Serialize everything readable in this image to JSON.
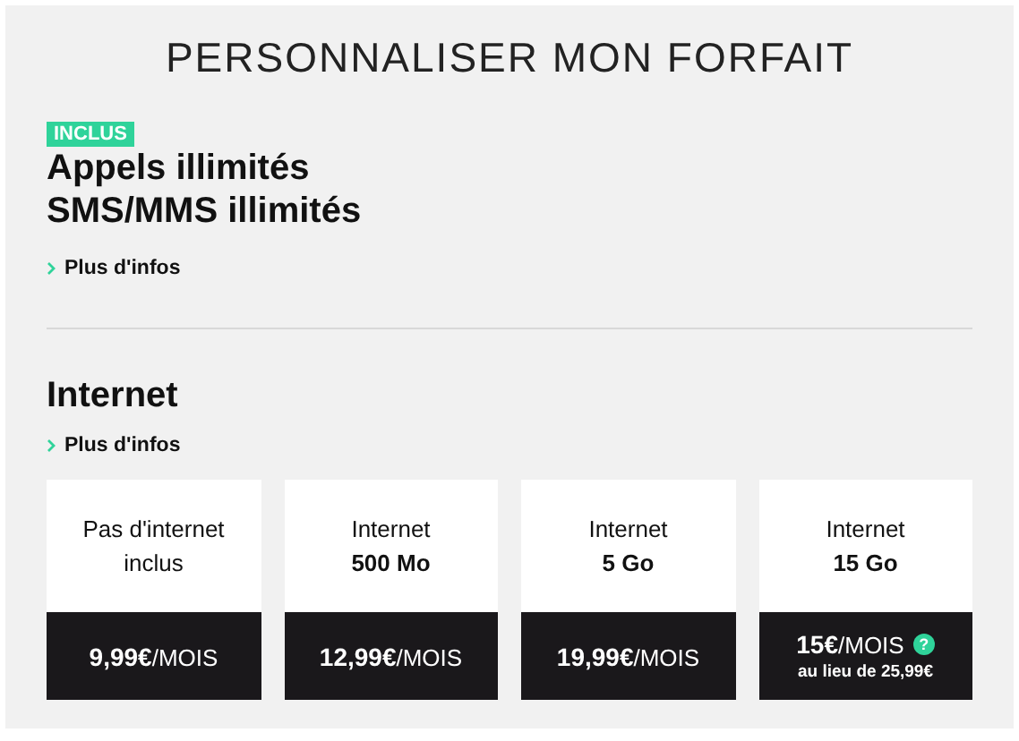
{
  "title": "PERSONNALISER MON FORFAIT",
  "included": {
    "badge": "INCLUS",
    "lines": [
      "Appels illimités",
      "SMS/MMS illimités"
    ],
    "more_link": "Plus d'infos"
  },
  "internet": {
    "heading": "Internet",
    "more_link": "Plus d'infos",
    "plans": [
      {
        "label": "Pas d'internet inclus",
        "price": "**9,99€**/MOIS"
      },
      {
        "label": "Internet",
        "allowance": "500 Mo",
        "price": "**12,99€**/MOIS"
      },
      {
        "label": "Internet",
        "allowance": "5 Go",
        "price": "**19,99€**/MOIS"
      },
      {
        "label": "Internet",
        "allowance": "15 Go",
        "price": "**15€**/MOIS",
        "help": "?",
        "was": "au lieu de 25,99€"
      }
    ]
  }
}
